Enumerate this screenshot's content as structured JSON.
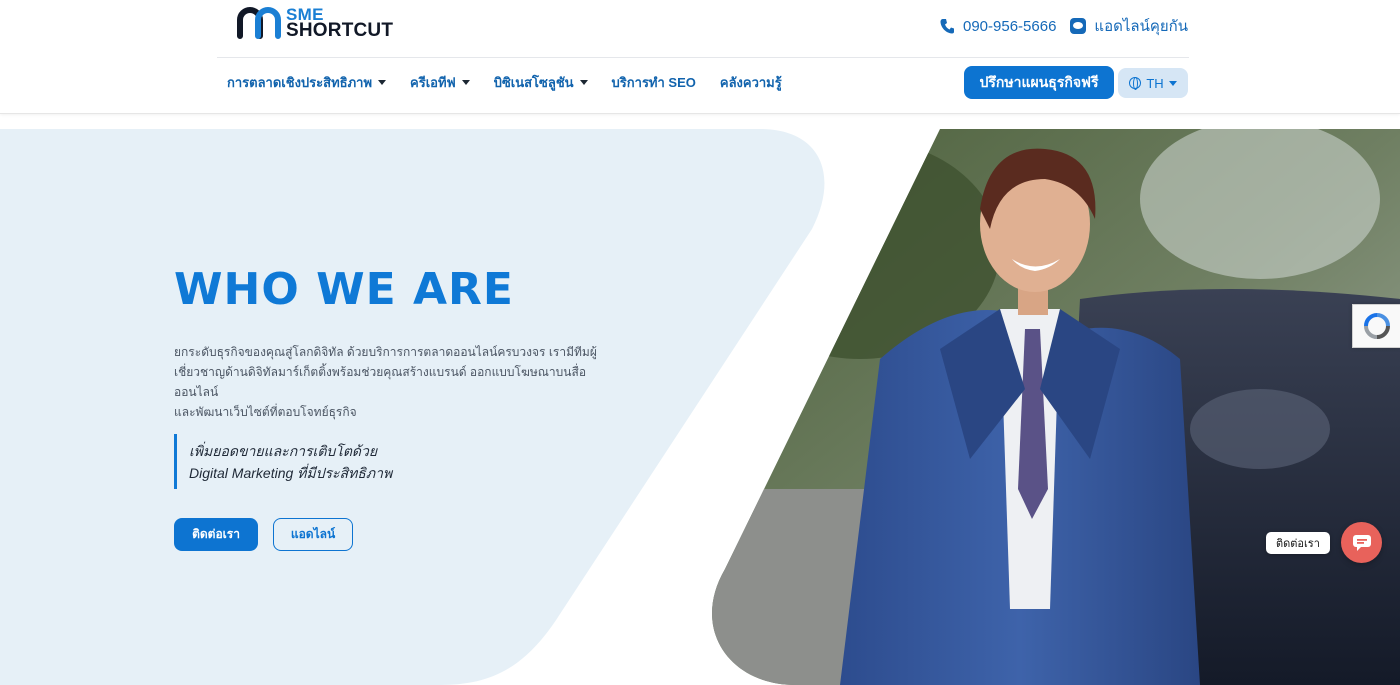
{
  "header": {
    "logo": {
      "line1": "SME",
      "line2": "SHORTCUT"
    },
    "contact": {
      "phone": "090-956-5666",
      "line_label": "แอดไลน์คุยกัน"
    },
    "nav": [
      {
        "label": "การตลาดเชิงประสิทธิภาพ",
        "has_dropdown": true
      },
      {
        "label": "ครีเอทีฟ",
        "has_dropdown": true
      },
      {
        "label": "บิซิเนสโซลูชัน",
        "has_dropdown": true
      },
      {
        "label": "บริการทำ SEO",
        "has_dropdown": false
      },
      {
        "label": "คลังความรู้",
        "has_dropdown": false
      }
    ],
    "cta_label": "ปรึกษาแผนธุรกิจฟรี",
    "language": "TH"
  },
  "hero": {
    "title": "WHO WE ARE",
    "description_lines": [
      "ยกระดับธุรกิจของคุณสู่โลกดิจิทัล ด้วยบริการการตลาดออนไลน์ครบวงจร เรามีทีมผู้",
      "เชี่ยวชาญด้านดิจิทัลมาร์เก็ตติ้งพร้อมช่วยคุณสร้างแบรนด์ ออกแบบโฆษณาบนสื่อออนไลน์",
      "และพัฒนาเว็บไซต์ที่ตอบโจทย์ธุรกิจ"
    ],
    "quote_lines": [
      "เพิ่มยอดขายและการเติบโตด้วย",
      "Digital Marketing ที่มีประสิทธิภาพ"
    ],
    "primary_button": "ติดต่อเรา",
    "secondary_button": "แอดไลน์"
  },
  "chat_widget": {
    "label": "ติดต่อเรา"
  },
  "colors": {
    "brand_blue": "#0d74d1",
    "hero_bg": "#e6f0f7",
    "chat_red": "#e8625b"
  },
  "icons": [
    "phone-icon",
    "line-icon",
    "globe-icon",
    "recaptcha-icon",
    "chat-icon"
  ]
}
